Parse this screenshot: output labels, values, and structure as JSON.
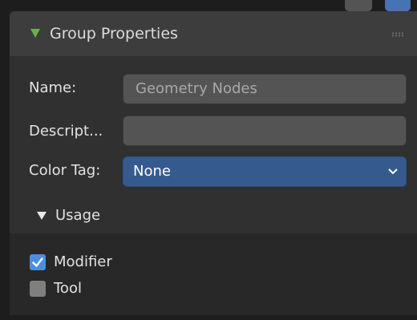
{
  "header": {
    "title": "Group Properties",
    "icon": "triangle-down-icon",
    "grip_icon": "drag-grip-icon"
  },
  "fields": {
    "name": {
      "label": "Name:",
      "value": "Geometry Nodes"
    },
    "description": {
      "label": "Descript...",
      "value": ""
    },
    "color_tag": {
      "label": "Color Tag:",
      "value": "None",
      "icon": "chevron-down-icon"
    }
  },
  "usage": {
    "title": "Usage",
    "items": [
      {
        "label": "Modifier",
        "checked": true
      },
      {
        "label": "Tool",
        "checked": false
      }
    ]
  },
  "colors": {
    "panel_bg": "#303030",
    "header_bg": "#3d3d3d",
    "accent_green": "#6ab04c",
    "select_blue": "#355b8e",
    "checkbox_blue": "#4b8fdc"
  }
}
